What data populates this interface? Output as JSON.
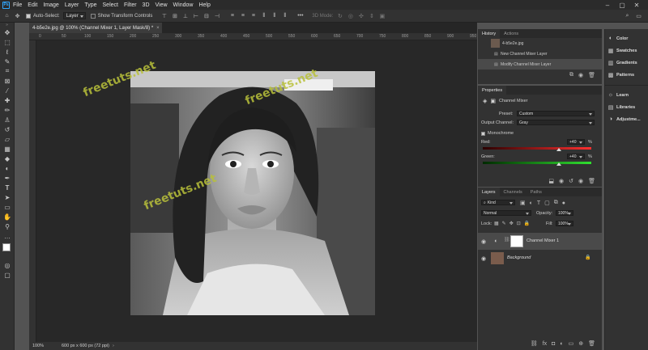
{
  "app": {
    "logo_text": "Ps"
  },
  "menu": [
    "File",
    "Edit",
    "Image",
    "Layer",
    "Type",
    "Select",
    "Filter",
    "3D",
    "View",
    "Window",
    "Help"
  ],
  "window_controls": {
    "min": "–",
    "max": "▢",
    "close": "✕"
  },
  "options": {
    "auto_select_label": "Auto-Select:",
    "auto_select_value": "Layer",
    "transform_label": "Show Transform Controls",
    "mode3d_label": "3D Mode:"
  },
  "document": {
    "tab_title": "4-b5e2e.jpg @ 100% (Channel Mixer 1, Layer Mask/8) *",
    "close": "×",
    "ruler_marks": [
      "0",
      "50",
      "100",
      "150",
      "200",
      "250",
      "300",
      "350",
      "400",
      "450",
      "500",
      "550",
      "600",
      "650",
      "700",
      "750",
      "800",
      "850",
      "900",
      "950"
    ]
  },
  "status": {
    "zoom": "100%",
    "doc_info": "600 px x 600 px (72 ppi)"
  },
  "watermark": "freetuts.net",
  "history": {
    "tabs": [
      "History",
      "Actions"
    ],
    "snapshot_label": "4-b5e2e.jpg",
    "items": [
      "New Channel Mixer Layer",
      "Modify Channel Mixer Layer"
    ]
  },
  "properties": {
    "tab": "Properties",
    "title": "Channel Mixer",
    "preset_label": "Preset:",
    "preset_value": "Custom",
    "output_label": "Output Channel:",
    "output_value": "Gray",
    "monochrome_label": "Monochrome",
    "red_label": "Red:",
    "red_value": "+40",
    "green_label": "Green:",
    "green_value": "+40",
    "pct": "%",
    "red_fraction": 0.7,
    "green_fraction": 0.7
  },
  "layers": {
    "tabs": [
      "Layers",
      "Channels",
      "Paths"
    ],
    "filter_value": "Kind",
    "blend_mode": "Normal",
    "opacity_label": "Opacity:",
    "opacity_value": "100%",
    "lock_label": "Lock:",
    "fill_label": "Fill:",
    "fill_value": "100%",
    "items": [
      {
        "name": "Channel Mixer 1"
      },
      {
        "name": "Background"
      }
    ]
  },
  "side_panel": {
    "items": [
      {
        "label": "Color"
      },
      {
        "label": "Swatches"
      },
      {
        "label": "Gradients"
      },
      {
        "label": "Patterns"
      },
      {
        "label": "Learn"
      },
      {
        "label": "Libraries"
      },
      {
        "label": "Adjustme..."
      }
    ]
  },
  "colors": {
    "accent": "#31a8ff",
    "panel": "#323232",
    "canvas": "#282828",
    "watermark": "#b9c13a"
  }
}
